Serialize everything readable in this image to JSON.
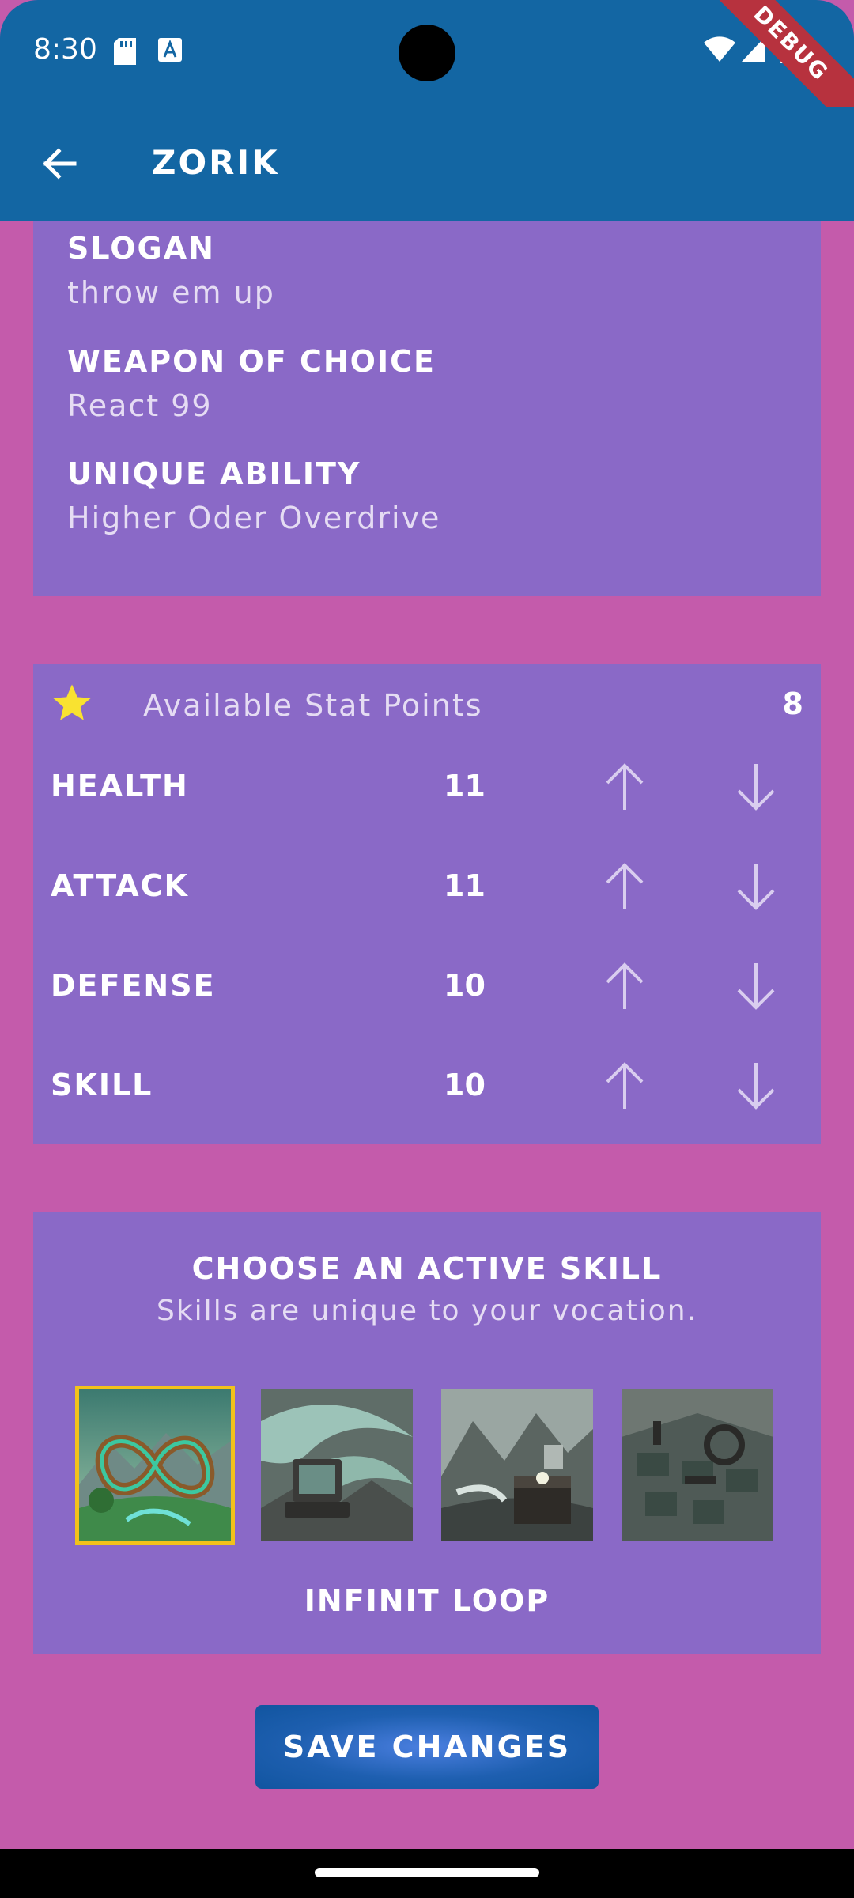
{
  "status": {
    "time": "8:30"
  },
  "debug": "DEBUG",
  "app_bar": {
    "title": "ZORIK"
  },
  "info": {
    "slogan_label": "SLOGAN",
    "slogan_value": "throw em up",
    "weapon_label": "WEAPON OF CHOICE",
    "weapon_value": "React 99",
    "ability_label": "UNIQUE ABILITY",
    "ability_value": "Higher Oder Overdrive"
  },
  "stats": {
    "available_label": "Available Stat Points",
    "available_value": "8",
    "rows": [
      {
        "name": "HEALTH",
        "value": "11"
      },
      {
        "name": "ATTACK",
        "value": "11"
      },
      {
        "name": "DEFENSE",
        "value": "10"
      },
      {
        "name": "SKILL",
        "value": "10"
      }
    ]
  },
  "skill": {
    "title": "CHOOSE AN ACTIVE SKILL",
    "subtitle": "Skills are unique to your vocation.",
    "selected_name": "INFINIT LOOP",
    "options": [
      "infinity-loop-art",
      "computer-vortex-art",
      "treasure-chest-art",
      "machine-grid-art"
    ]
  },
  "save_button": "SAVE CHANGES",
  "colors": {
    "background": "#c45bab",
    "app_bar": "#1366a3",
    "card": "#8a69c7",
    "selected_outline": "#f2c21b"
  }
}
